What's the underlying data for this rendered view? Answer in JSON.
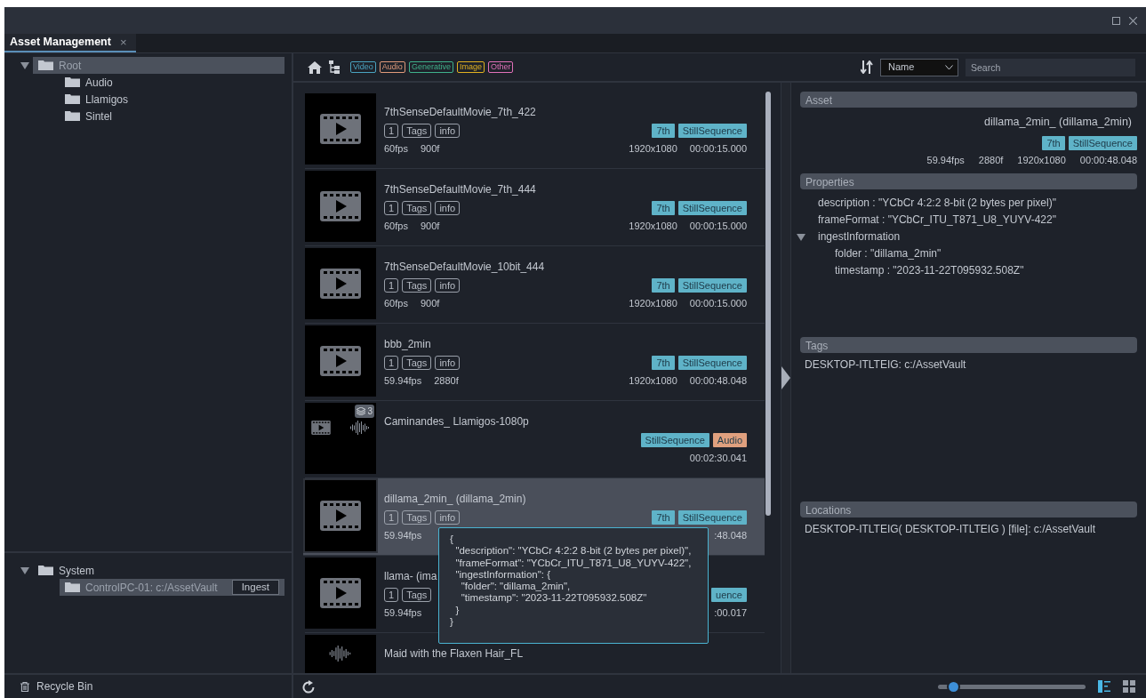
{
  "tabs": [
    {
      "label": "Asset Management",
      "close": "×",
      "selected": true
    }
  ],
  "tree": [
    {
      "label": "Root",
      "expanded": true,
      "selected": true,
      "children": [
        {
          "label": "Audio",
          "selected": false
        },
        {
          "label": "Llamigos",
          "selected": false
        },
        {
          "label": "Sintel",
          "selected": false
        }
      ]
    }
  ],
  "system_tree": [
    {
      "label": "System",
      "expanded": true,
      "selected": false,
      "children": [
        {
          "label": "ControlPC-01: c:/AssetVault",
          "selected": true,
          "action": "Ingest"
        }
      ]
    }
  ],
  "recycle_bin": {
    "label": "Recycle Bin"
  },
  "filters": [
    {
      "label": "Video",
      "color": "#4aa3c0"
    },
    {
      "label": "Audio",
      "color": "#e09a7a"
    },
    {
      "label": "Generative",
      "color": "#3fb08a"
    },
    {
      "label": "Image",
      "color": "#e0b020"
    },
    {
      "label": "Other",
      "color": "#e070b8"
    }
  ],
  "sort": {
    "value": "Name"
  },
  "search": {
    "placeholder": "Search"
  },
  "assets": [
    {
      "kind": "video",
      "selected": false,
      "title": "7thSenseDefaultMovie_7th_422",
      "chips": [
        "1",
        "Tags",
        "info"
      ],
      "fps": "60fps",
      "frames": "900f",
      "badges": [
        {
          "label": "7th",
          "color": "#5fb3c8"
        },
        {
          "label": "StillSequence",
          "color": "#5fb3c8"
        }
      ],
      "resolution": "1920x1080",
      "duration": "00:00:15.000"
    },
    {
      "kind": "video",
      "selected": false,
      "title": "7thSenseDefaultMovie_7th_444",
      "chips": [
        "1",
        "Tags",
        "info"
      ],
      "fps": "60fps",
      "frames": "900f",
      "badges": [
        {
          "label": "7th",
          "color": "#5fb3c8"
        },
        {
          "label": "StillSequence",
          "color": "#5fb3c8"
        }
      ],
      "resolution": "1920x1080",
      "duration": "00:00:15.000"
    },
    {
      "kind": "video",
      "selected": false,
      "title": "7thSenseDefaultMovie_10bit_444",
      "chips": [
        "1",
        "Tags",
        "info"
      ],
      "fps": "60fps",
      "frames": "900f",
      "badges": [
        {
          "label": "7th",
          "color": "#5fb3c8"
        },
        {
          "label": "StillSequence",
          "color": "#5fb3c8"
        }
      ],
      "resolution": "1920x1080",
      "duration": "00:00:15.000"
    },
    {
      "kind": "video",
      "selected": false,
      "title": "bbb_2min",
      "chips": [
        "1",
        "Tags",
        "info"
      ],
      "fps": "59.94fps",
      "frames": "2880f",
      "badges": [
        {
          "label": "7th",
          "color": "#5fb3c8"
        },
        {
          "label": "StillSequence",
          "color": "#5fb3c8"
        }
      ],
      "resolution": "1920x1080",
      "duration": "00:00:48.048"
    },
    {
      "kind": "mixed",
      "selected": false,
      "count": "3",
      "title": "Caminandes_ Llamigos-1080p",
      "badges": [
        {
          "label": "StillSequence",
          "color": "#5fb3c8"
        },
        {
          "label": "Audio",
          "color": "#e0a07e"
        }
      ],
      "duration": "00:02:30.041"
    },
    {
      "kind": "video",
      "selected": true,
      "title": "dillama_2min_ (dillama_2min)",
      "chips": [
        "1",
        "Tags",
        "info"
      ],
      "fps": "59.94fps",
      "badges": [
        {
          "label": "7th",
          "color": "#5fb3c8"
        },
        {
          "label": "StillSequence",
          "color": "#5fb3c8"
        }
      ],
      "duration": ":48.048"
    },
    {
      "kind": "video",
      "selected": false,
      "title": "llama- (ima",
      "chips": [
        "1",
        "Tags"
      ],
      "fps": "59.94fps",
      "badges": [
        {
          "label": "uence",
          "color": "#5fb3c8"
        }
      ],
      "duration": ":00.017"
    },
    {
      "kind": "audio",
      "selected": false,
      "title": "Maid with the Flaxen Hair_FL"
    }
  ],
  "tooltip": {
    "text": "{\n  \"description\": \"YCbCr 4:2:2 8-bit (2 bytes per pixel)\",\n  \"frameFormat\": \"YCbCr_ITU_T871_U8_YUYV-422\",\n  \"ingestInformation\": {\n    \"folder\": \"dillama_2min\",\n    \"timestamp\": \"2023-11-22T095932.508Z\"\n  }\n}"
  },
  "details": {
    "asset": {
      "title": "Asset",
      "name": "dillama_2min_ (dillama_2min)",
      "badges": [
        {
          "label": "7th",
          "color": "#5fb3c8"
        },
        {
          "label": "StillSequence",
          "color": "#5fb3c8"
        }
      ],
      "meta": [
        "59.94fps",
        "2880f",
        "1920x1080",
        "00:00:48.048"
      ]
    },
    "properties": {
      "title": "Properties",
      "items": [
        {
          "text": "description : \"YCbCr 4:2:2 8-bit (2 bytes per pixel)\""
        },
        {
          "text": "frameFormat : \"YCbCr_ITU_T871_U8_YUYV-422\""
        },
        {
          "text": "ingestInformation",
          "expanded": true,
          "children": [
            {
              "text": "folder : \"dillama_2min\""
            },
            {
              "text": "timestamp : \"2023-11-22T095932.508Z\""
            }
          ]
        }
      ]
    },
    "tags": {
      "title": "Tags",
      "items": [
        "DESKTOP-ITLTEIG: c:/AssetVault"
      ]
    },
    "locations": {
      "title": "Locations",
      "items": [
        "DESKTOP-ITLTEIG( DESKTOP-ITLTEIG ) [file]: c:/AssetVault"
      ]
    }
  },
  "zoom_slider": {
    "level": 0.1
  },
  "view_modes": [
    {
      "kind": "list",
      "selected": true
    },
    {
      "kind": "grid",
      "selected": false
    }
  ]
}
